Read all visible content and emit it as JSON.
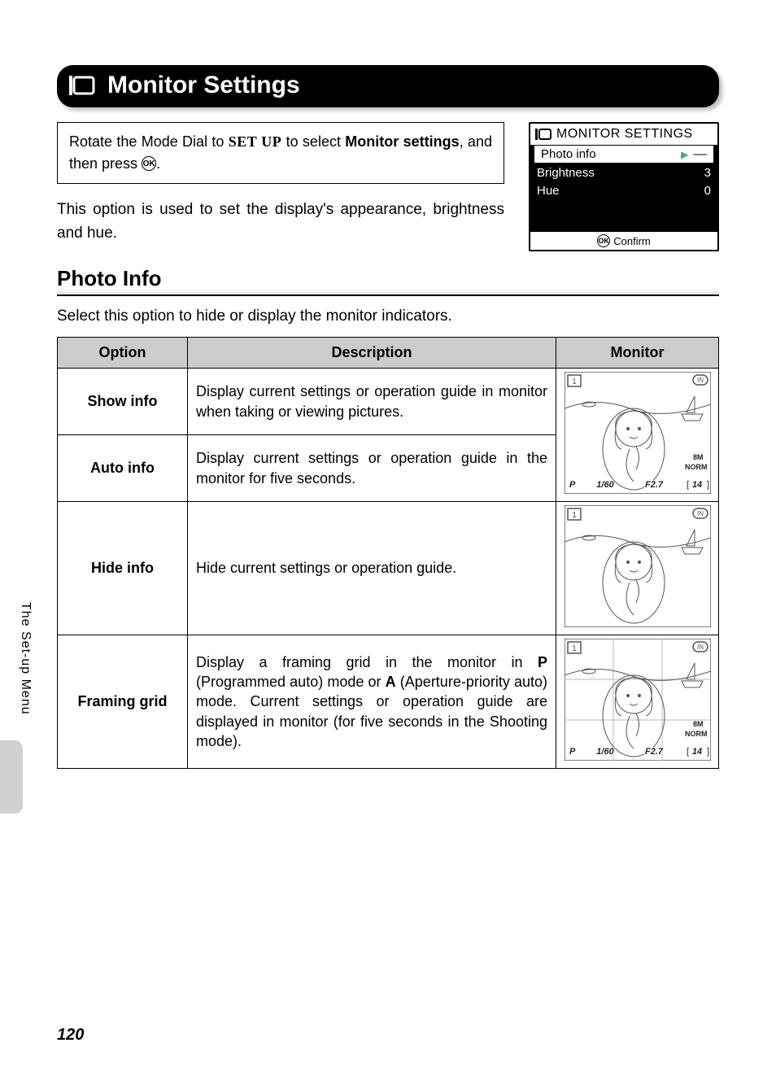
{
  "title": "Monitor Settings",
  "instruction": {
    "prefix": "Rotate the Mode Dial to ",
    "setup": "SET UP",
    "mid": " to select ",
    "bold": "Monitor settings",
    "suffix": ", and then press ",
    "icon_label": "OK",
    "end": "."
  },
  "intro": "This option is used to set the display's appearance, brightness and hue.",
  "screen": {
    "header": "MONITOR SETTINGS",
    "rows": [
      {
        "label": "Photo info",
        "value": "––",
        "selected": true
      },
      {
        "label": "Brightness",
        "value": "3",
        "selected": false
      },
      {
        "label": "Hue",
        "value": "0",
        "selected": false
      }
    ],
    "confirm": "Confirm",
    "ok": "OK"
  },
  "section": {
    "heading": "Photo Info",
    "desc": "Select this option to hide or display the monitor indicators."
  },
  "table": {
    "headers": {
      "option": "Option",
      "description": "Description",
      "monitor": "Monitor"
    },
    "rows": [
      {
        "option": "Show info",
        "description": "Display current settings or operation guide in monitor when taking or viewing pictures."
      },
      {
        "option": "Auto info",
        "description": "Display current settings or operation guide in the monitor for five seconds."
      },
      {
        "option": "Hide info",
        "description": "Hide current settings or operation guide."
      },
      {
        "option": "Framing grid",
        "desc_parts": {
          "p1": "Display a framing grid in the monitor in ",
          "b1": "P",
          "p2": " (Programmed auto) mode or ",
          "b2": "A",
          "p3": " (Aperture-priority auto) mode. Current settings or operation guide are displayed in monitor (for five seconds in the Shooting mode)."
        }
      }
    ]
  },
  "overlay": {
    "mode": "P",
    "shutter": "1/60",
    "aperture": "F2.7",
    "quality1": "8M",
    "quality2": "NORM",
    "count": "14",
    "in": "IN",
    "one": "1"
  },
  "side_label": "The Set-up Menu",
  "page_number": "120"
}
